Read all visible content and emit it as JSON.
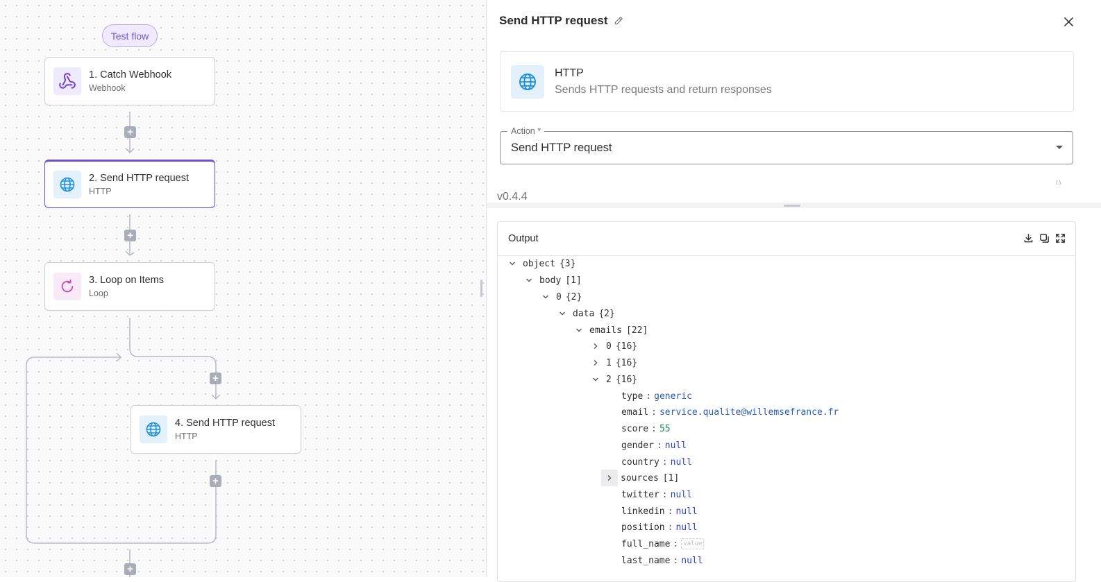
{
  "canvas": {
    "test_flow_label": "Test flow",
    "nodes": [
      {
        "title": "1. Catch Webhook",
        "subtitle": "Webhook",
        "icon": "webhook-icon"
      },
      {
        "title": "2. Send HTTP request",
        "subtitle": "HTTP",
        "icon": "globe-icon",
        "selected": true
      },
      {
        "title": "3. Loop on Items",
        "subtitle": "Loop",
        "icon": "loop-icon"
      },
      {
        "title": "4. Send HTTP request",
        "subtitle": "HTTP",
        "icon": "globe-icon"
      }
    ]
  },
  "panel": {
    "title": "Send HTTP request",
    "piece": {
      "name": "HTTP",
      "description": "Sends HTTP requests and return responses"
    },
    "action": {
      "label": "Action *",
      "value": "Send HTTP request"
    },
    "version": "v0.4.4",
    "tiny_mark": "/.\\"
  },
  "output": {
    "title": "Output",
    "tree": {
      "root": {
        "key": "object",
        "count": "{3}"
      },
      "body": {
        "key": "body",
        "count": "[1]"
      },
      "item0": {
        "key": "0",
        "count": "{2}"
      },
      "data": {
        "key": "data",
        "count": "{2}"
      },
      "emails": {
        "key": "emails",
        "count": "[22]"
      },
      "e0": {
        "key": "0",
        "count": "{16}"
      },
      "e1": {
        "key": "1",
        "count": "{16}"
      },
      "e2": {
        "key": "2",
        "count": "{16}"
      },
      "fields": {
        "type": {
          "key": "type",
          "value": "generic"
        },
        "email": {
          "key": "email",
          "value": "service.qualite@willemsefrance.fr"
        },
        "score": {
          "key": "score",
          "value": "55"
        },
        "gender": {
          "key": "gender",
          "value": "null"
        },
        "country": {
          "key": "country",
          "value": "null"
        },
        "sources": {
          "key": "sources",
          "count": "[1]"
        },
        "twitter": {
          "key": "twitter",
          "value": "null"
        },
        "linkedin": {
          "key": "linkedin",
          "value": "null"
        },
        "position": {
          "key": "position",
          "value": "null"
        },
        "full_name": {
          "key": "full_name",
          "placeholder": "value"
        },
        "last_name": {
          "key": "last_name",
          "value": "null"
        }
      }
    }
  },
  "colors": {
    "accent": "#6b4fd8",
    "http_blue": "#1a8fe3",
    "string_value": "#2b5cb8",
    "number_value": "#1e8a4c",
    "null_value": "#2b46b8"
  }
}
